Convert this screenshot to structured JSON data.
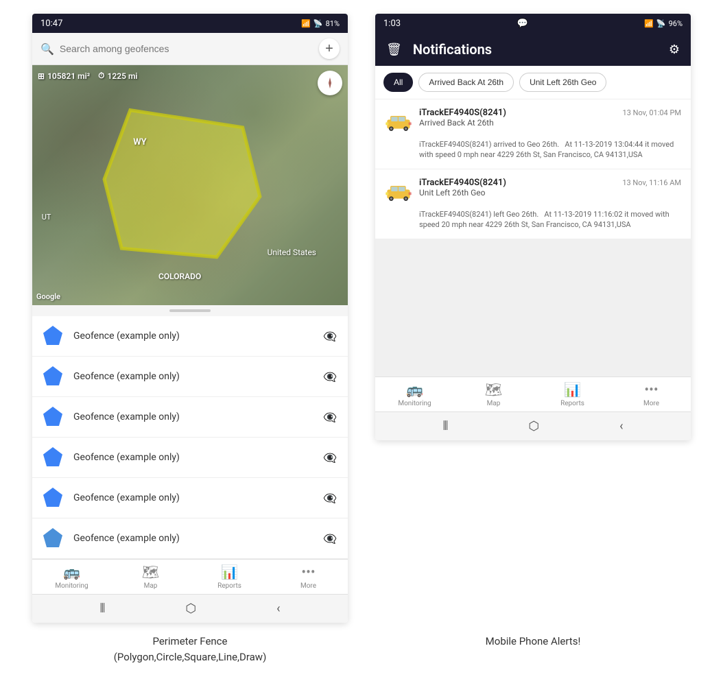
{
  "left_phone": {
    "status_bar": {
      "time": "10:47",
      "wifi": "WiFi",
      "signal": "Signal",
      "battery": "81%"
    },
    "search": {
      "placeholder": "Search among geofences"
    },
    "map": {
      "stat1": "105821 mi²",
      "stat2": "1225 mi",
      "label_wy": "WY",
      "label_us": "United States",
      "label_colorado": "COLORADO",
      "label_utah": "UT"
    },
    "geofences": [
      "Geofence (example only)",
      "Geofence (example only)",
      "Geofence (example only)",
      "Geofence (example only)",
      "Geofence (example only)",
      "Geofence (example only)"
    ],
    "nav": {
      "items": [
        {
          "label": "Monitoring",
          "icon": "🚌"
        },
        {
          "label": "Map",
          "icon": "🗺"
        },
        {
          "label": "Reports",
          "icon": "📊"
        },
        {
          "label": "More",
          "icon": "···"
        }
      ]
    }
  },
  "right_phone": {
    "status_bar": {
      "time": "1:03",
      "chat": "💬",
      "wifi": "WiFi",
      "signal": "Signal",
      "battery": "96%"
    },
    "header": {
      "title": "Notifications",
      "delete_label": "🗑",
      "settings_label": "⚙"
    },
    "filter_tabs": [
      "All",
      "Arrived Back At 26th",
      "Unit Left 26th Geo"
    ],
    "notifications": [
      {
        "device": "iTrackEF4940S(8241)",
        "time": "13 Nov, 01:04 PM",
        "event": "Arrived Back At 26th",
        "body": "iTrackEF4940S(8241) arrived to Geo 26th.   At 11-13-2019 13:04:44 it moved with speed 0 mph near 4229 26th St, San Francisco, CA 94131,USA"
      },
      {
        "device": "iTrackEF4940S(8241)",
        "time": "13 Nov, 11:16 AM",
        "event": "Unit Left 26th Geo",
        "body": "iTrackEF4940S(8241) left Geo 26th.   At 11-13-2019 11:16:02 it moved with speed 20 mph near 4229 26th St, San Francisco, CA 94131,USA"
      }
    ],
    "nav": {
      "items": [
        {
          "label": "Monitoring",
          "icon": "🚌"
        },
        {
          "label": "Map",
          "icon": "🗺"
        },
        {
          "label": "Reports",
          "icon": "📊"
        },
        {
          "label": "More",
          "icon": "···"
        }
      ]
    }
  },
  "captions": {
    "left": "Perimeter Fence\n(Polygon,Circle,Square,Line,Draw)",
    "right": "Mobile Phone Alerts!"
  }
}
